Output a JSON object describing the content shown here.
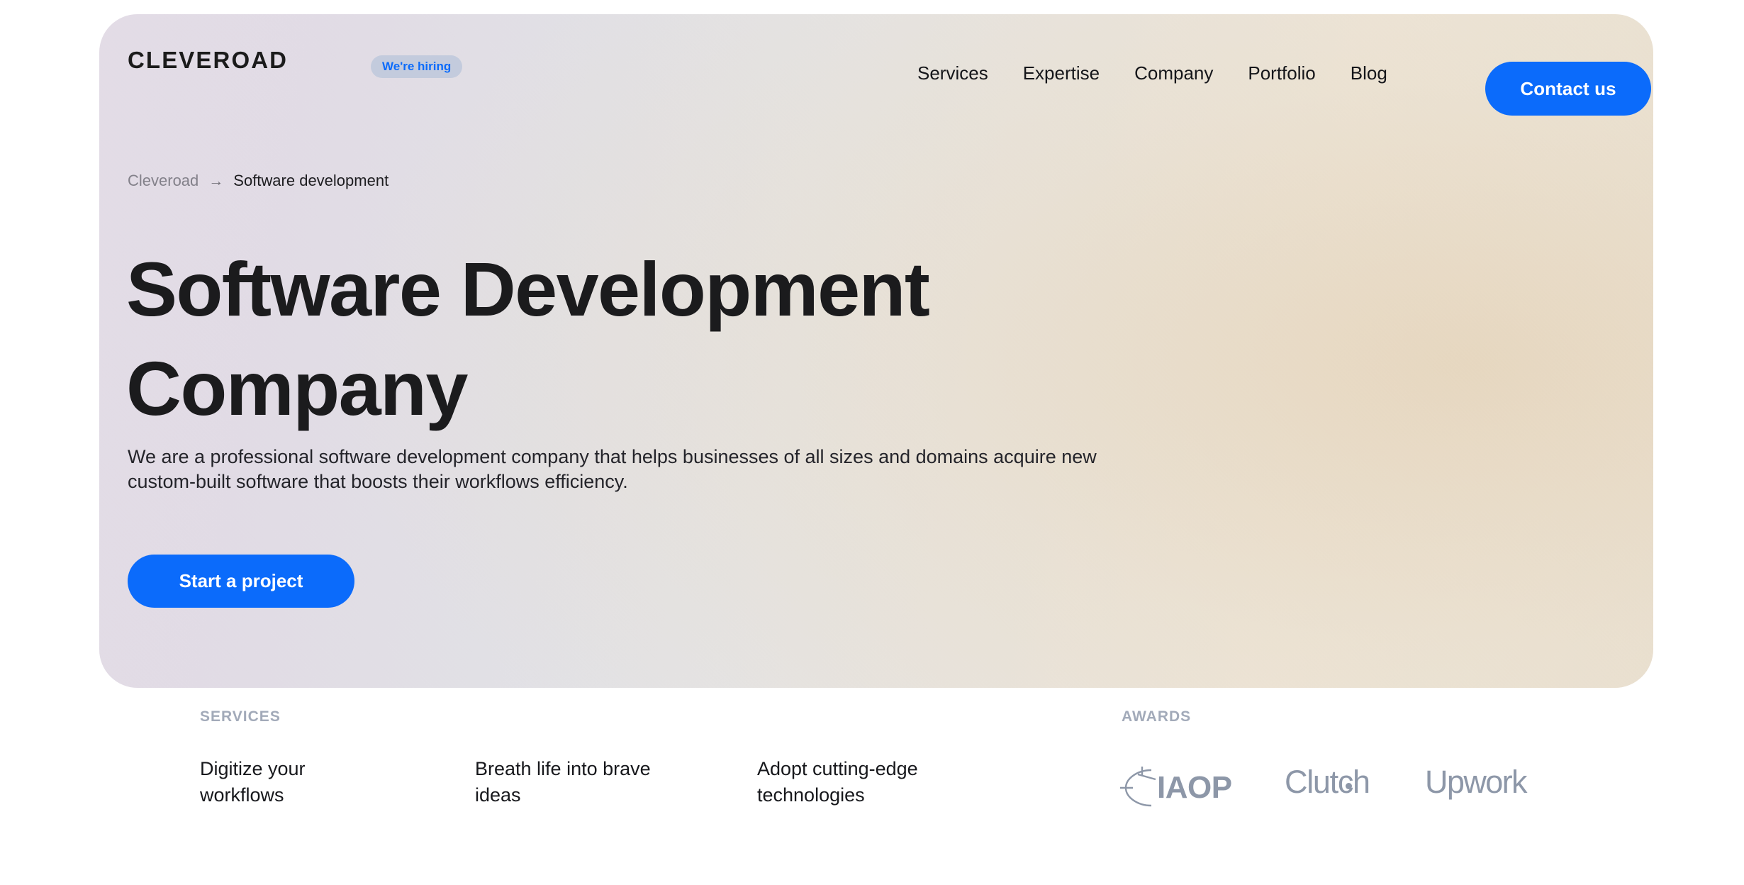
{
  "brand": {
    "logo_text": "CLEVEROAD",
    "hiring_badge": "We're hiring",
    "accent_color": "#0b6bfb",
    "muted_color": "#a2aab9"
  },
  "nav": {
    "links": [
      {
        "label": "Services"
      },
      {
        "label": "Expertise"
      },
      {
        "label": "Company"
      },
      {
        "label": "Portfolio"
      },
      {
        "label": "Blog"
      }
    ],
    "contact_button": "Contact us"
  },
  "breadcrumb": {
    "root": "Cleveroad",
    "separator": "→",
    "current": "Software development"
  },
  "hero": {
    "headline": "Software Development Company",
    "subtitle": "We are a professional software development company that helps businesses of all sizes and domains acquire new custom-built software that boosts their workflows efficiency.",
    "cta": "Start a project"
  },
  "services": {
    "label": "SERVICES",
    "items": [
      {
        "title": "Digitize your workflows"
      },
      {
        "title": "Breath life into brave ideas"
      },
      {
        "title": "Adopt cutting-edge technologies"
      }
    ]
  },
  "awards": {
    "label": "AWARDS",
    "items": [
      {
        "name": "IAOP"
      },
      {
        "name": "Clutch"
      },
      {
        "name": "Upwork"
      }
    ]
  }
}
